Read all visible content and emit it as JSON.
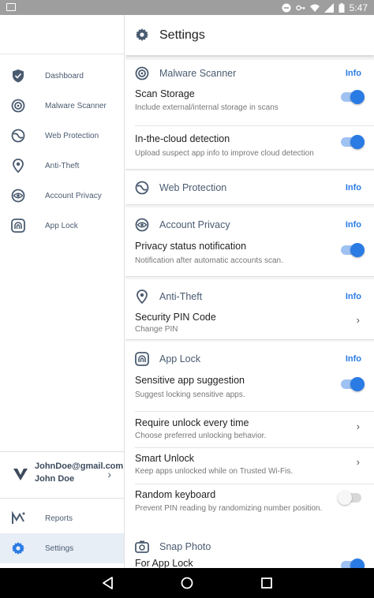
{
  "status_bar": {
    "time": "5:47"
  },
  "colors": {
    "accent": "#2a7be4",
    "status_bar": "#9e9e9e"
  },
  "drawer": {
    "items": [
      {
        "label": "Dashboard",
        "icon": "shield-icon"
      },
      {
        "label": "Malware Scanner",
        "icon": "scanner-icon"
      },
      {
        "label": "Web Protection",
        "icon": "globe-icon"
      },
      {
        "label": "Anti-Theft",
        "icon": "location-pin-icon"
      },
      {
        "label": "Account Privacy",
        "icon": "eye-icon"
      },
      {
        "label": "App Lock",
        "icon": "fingerprint-icon"
      }
    ],
    "account": {
      "email": "JohnDoe@gmail.com",
      "name": "John Doe"
    },
    "bottom_items": [
      {
        "label": "Reports",
        "icon": "reports-icon"
      },
      {
        "label": "Settings",
        "icon": "gear-icon",
        "active": true
      }
    ]
  },
  "main": {
    "title": "Settings",
    "info_label": "Info",
    "sections": {
      "malware": {
        "title": "Malware Scanner",
        "rows": [
          {
            "title": "Scan Storage",
            "subtitle": "Include external/internal storage in scans",
            "toggle": true
          },
          {
            "title": "In-the-cloud detection",
            "subtitle": "Upload suspect app info to improve cloud detection",
            "toggle": true
          }
        ]
      },
      "web": {
        "title": "Web Protection"
      },
      "privacy": {
        "title": "Account Privacy",
        "rows": [
          {
            "title": "Privacy status notification",
            "subtitle": "Notification after automatic accounts scan.",
            "toggle": true
          }
        ]
      },
      "antitheft": {
        "title": "Anti-Theft",
        "rows": [
          {
            "title": "Security PIN Code",
            "subtitle": "Change PIN"
          }
        ]
      },
      "applock": {
        "title": "App Lock",
        "rows": [
          {
            "title": "Sensitive app suggestion",
            "subtitle": "Suggest locking sensitive apps.",
            "toggle": true
          },
          {
            "title": "Require unlock every time",
            "subtitle": "Choose preferred unlocking behavior."
          },
          {
            "title": "Smart Unlock",
            "subtitle": "Keep apps unlocked while on Trusted Wi-Fis."
          },
          {
            "title": "Random keyboard",
            "subtitle": "Prevent PIN reading by randomizing number position.",
            "toggle": false
          }
        ]
      },
      "snap": {
        "title": "Snap Photo",
        "rows": [
          {
            "title": "For App Lock",
            "toggle": true
          }
        ]
      }
    }
  }
}
